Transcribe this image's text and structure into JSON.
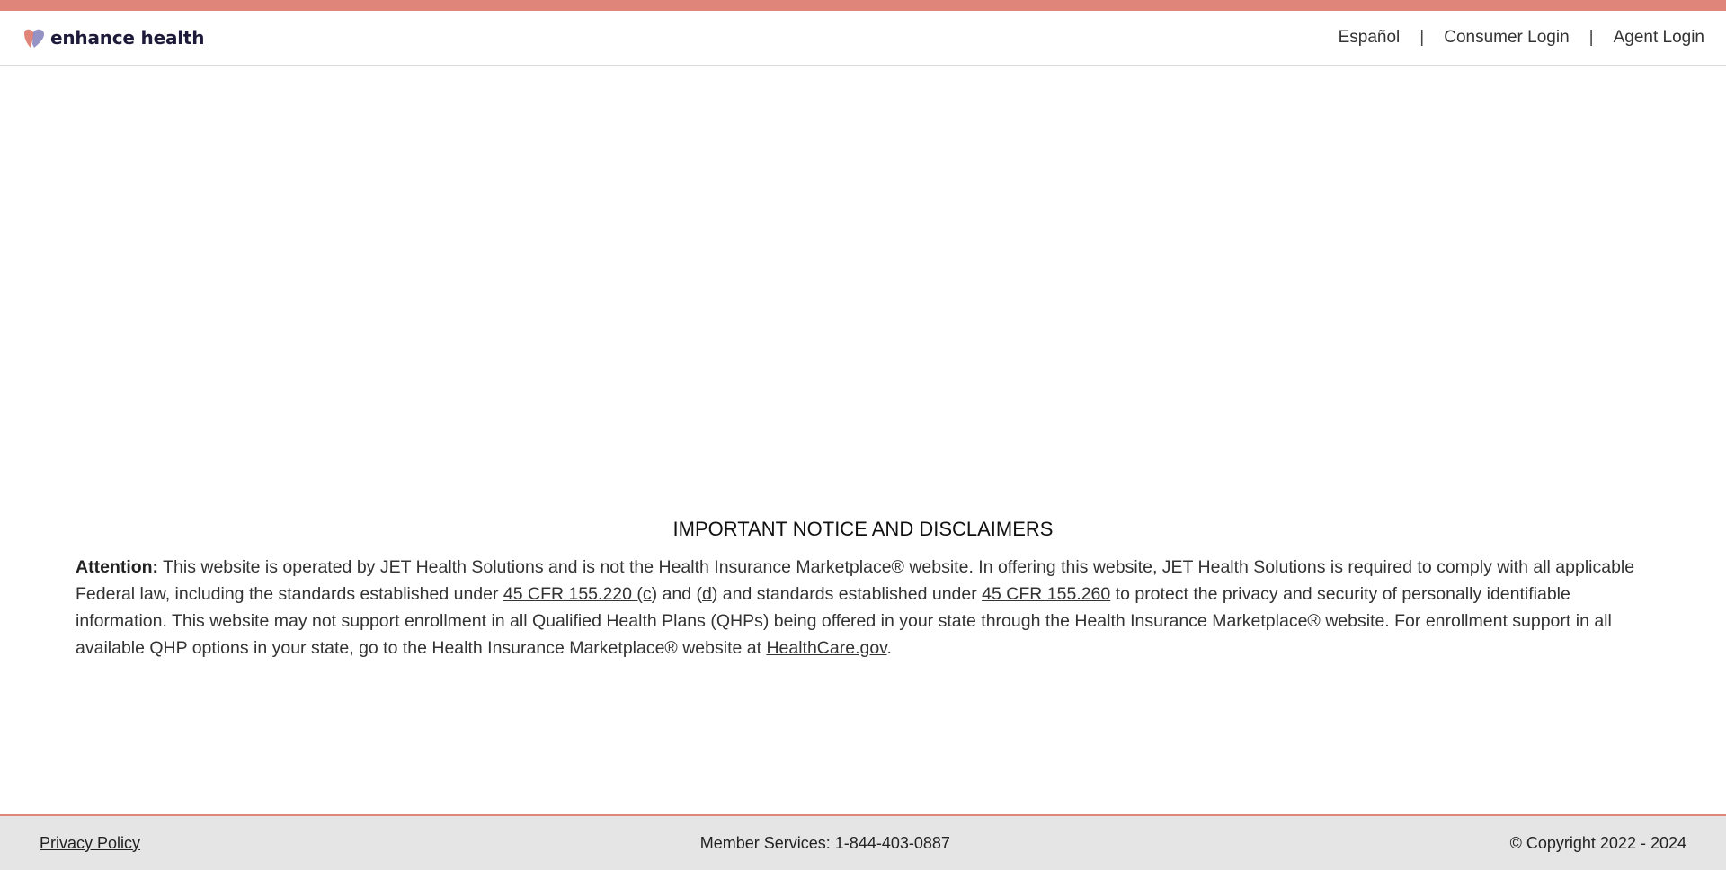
{
  "brand": {
    "name": "enhance health",
    "logo_colors": {
      "left": "#e0857a",
      "right": "#8a86c0"
    }
  },
  "nav": {
    "items": [
      {
        "label": "Español"
      },
      {
        "label": "Consumer Login"
      },
      {
        "label": "Agent Login"
      }
    ],
    "separator": "|"
  },
  "notice": {
    "title": "IMPORTANT NOTICE AND DISCLAIMERS",
    "attention_label": "Attention:",
    "text_1": " This website is operated by JET Health Solutions and is not the Health Insurance Marketplace® website. In offering this website, JET Health Solutions is required to comply with all applicable Federal law, including the standards established under ",
    "link_cfr_220": "45 CFR 155.220 (c",
    "text_2": ") and (",
    "link_d": "d",
    "text_3": ") and standards established under ",
    "link_cfr_260": "45 CFR 155.260",
    "text_4": " to protect the privacy and security of personally identifiable information. This website may not support enrollment in all Qualified Health Plans (QHPs) being offered in your state through the Health Insurance Marketplace® website. For enrollment support in all available QHP options in your state, go to the Health Insurance Marketplace® website at ",
    "link_healthcare": "HealthCare.gov",
    "text_5": "."
  },
  "footer": {
    "privacy_label": "Privacy Policy",
    "member_services": "Member Services: 1-844-403-0887",
    "copyright": "© Copyright 2022 - 2024"
  },
  "colors": {
    "accent": "#e0857a",
    "footer_bg": "#e5e5e5",
    "brand_text": "#1e1b3a"
  }
}
